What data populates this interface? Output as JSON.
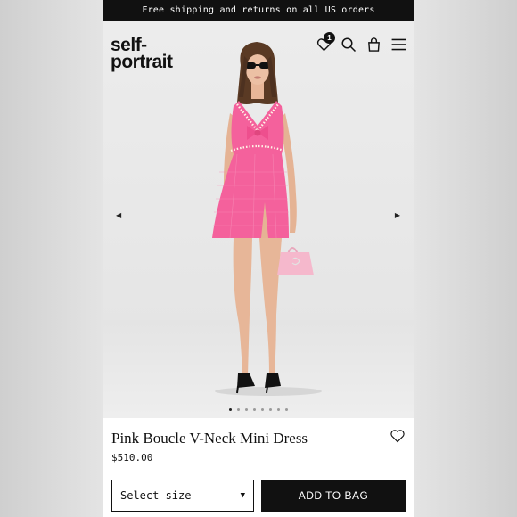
{
  "promo": {
    "text": "Free shipping and returns on all US orders"
  },
  "header": {
    "logo_line1": "self-",
    "logo_line2": "portrait",
    "wishlist_count": "1",
    "icons": [
      "heart-icon",
      "search-icon",
      "bag-icon",
      "menu-icon"
    ]
  },
  "gallery": {
    "prev_arrow": "◀",
    "next_arrow": "▶",
    "slide_count": 8,
    "active_slide": 1
  },
  "product": {
    "title": "Pink Boucle V-Neck Mini Dress",
    "price": "$510.00",
    "size_placeholder": "Select size",
    "size_caret": "▼",
    "add_to_bag_label": "ADD TO BAG"
  },
  "colors": {
    "dress": "#f4619c",
    "accent": "#111111",
    "background": "#ffffff"
  }
}
